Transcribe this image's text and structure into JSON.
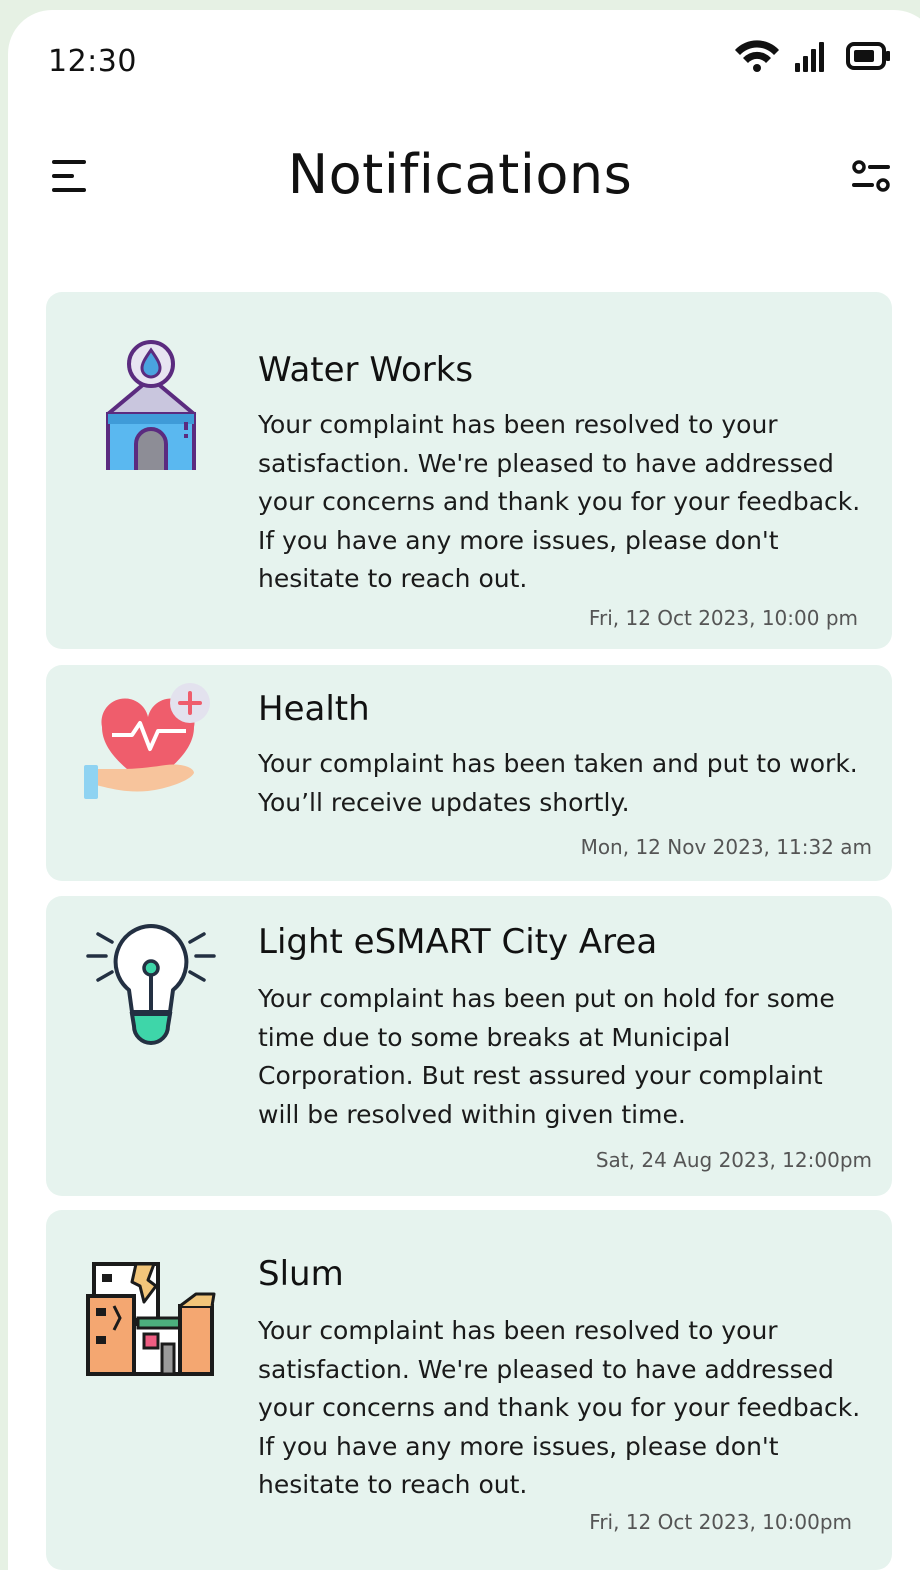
{
  "status_bar": {
    "time": "12:30",
    "icons": [
      "wifi-icon",
      "signal-icon",
      "battery-icon"
    ]
  },
  "header": {
    "title": "Notifications",
    "menu_icon": "menu-icon",
    "filter_icon": "filter-icon"
  },
  "notifications": [
    {
      "title": "Water Works",
      "body": "Your complaint has been resolved to your satisfaction. We're pleased to have addressed your concerns and thank you for your feedback. If you have any more issues, please don't hesitate to reach out.",
      "timestamp": "Fri, 12 Oct 2023, 10:00 pm",
      "icon": "water-works-icon"
    },
    {
      "title": "Health",
      "body": "Your complaint has been taken and put to work. You’ll receive updates shortly.",
      "timestamp": "Mon, 12 Nov 2023, 11:32 am",
      "icon": "health-icon"
    },
    {
      "title": "Light eSMART City Area",
      "body": "Your complaint has been put on hold for some time due to some breaks at Municipal Corporation. But rest assured your complaint will be resolved within given time.",
      "timestamp": "Sat, 24 Aug 2023, 12:00pm",
      "icon": "light-bulb-icon"
    },
    {
      "title": "Slum",
      "body": "Your complaint has been resolved to your satisfaction. We're pleased to have addressed your concerns and thank you for your feedback. If you have any more issues, please don't hesitate to reach out.",
      "timestamp": "Fri, 12 Oct 2023, 10:00pm",
      "icon": "slum-icon"
    }
  ]
}
